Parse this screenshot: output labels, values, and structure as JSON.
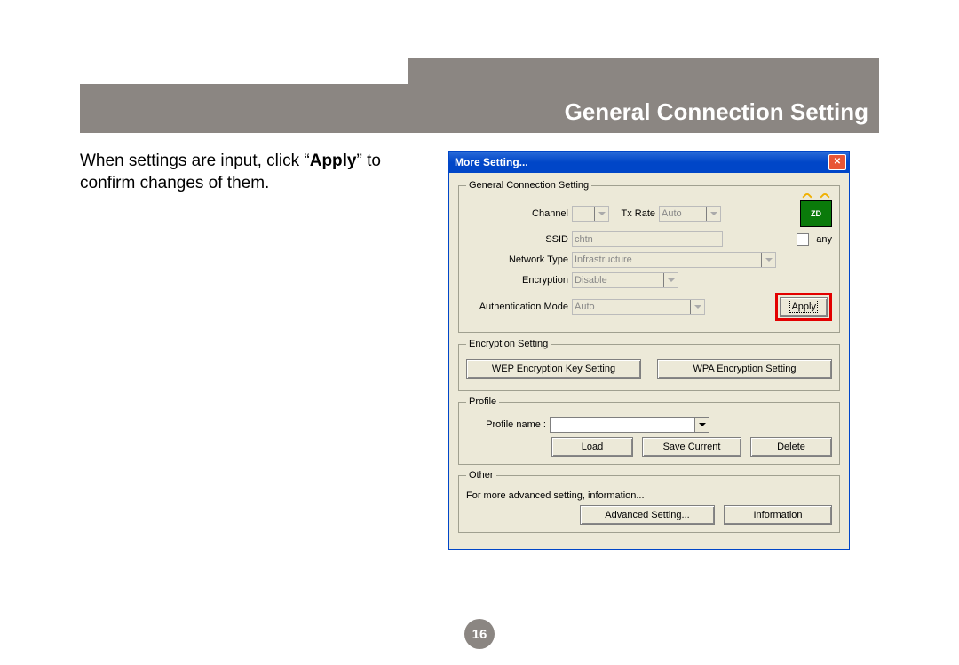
{
  "header": {
    "title": "General Connection Setting"
  },
  "instruction": {
    "prefix": "When settings are input, click “",
    "bold": "Apply",
    "suffix": "” to confirm changes of them."
  },
  "dialog": {
    "title": "More Setting...",
    "groups": {
      "general": {
        "legend": "General Connection Setting",
        "channel_label": "Channel",
        "channel_value": "",
        "txrate_label": "Tx Rate",
        "txrate_value": "Auto",
        "ssid_label": "SSID",
        "ssid_value": "chtn",
        "any_label": "any",
        "nettype_label": "Network Type",
        "nettype_value": "Infrastructure",
        "encryption_label": "Encryption",
        "encryption_value": "Disable",
        "auth_label": "Authentication Mode",
        "auth_value": "Auto",
        "apply": "Apply"
      },
      "encryption": {
        "legend": "Encryption Setting",
        "wep_btn": "WEP Encryption Key Setting",
        "wpa_btn": "WPA Encryption Setting"
      },
      "profile": {
        "legend": "Profile",
        "name_label": "Profile name :",
        "load": "Load",
        "save": "Save Current",
        "delete": "Delete"
      },
      "other": {
        "legend": "Other",
        "text": "For more advanced setting, information...",
        "advanced": "Advanced Setting...",
        "info": "Information"
      }
    },
    "icon_text": "ZD"
  },
  "page_number": "16"
}
